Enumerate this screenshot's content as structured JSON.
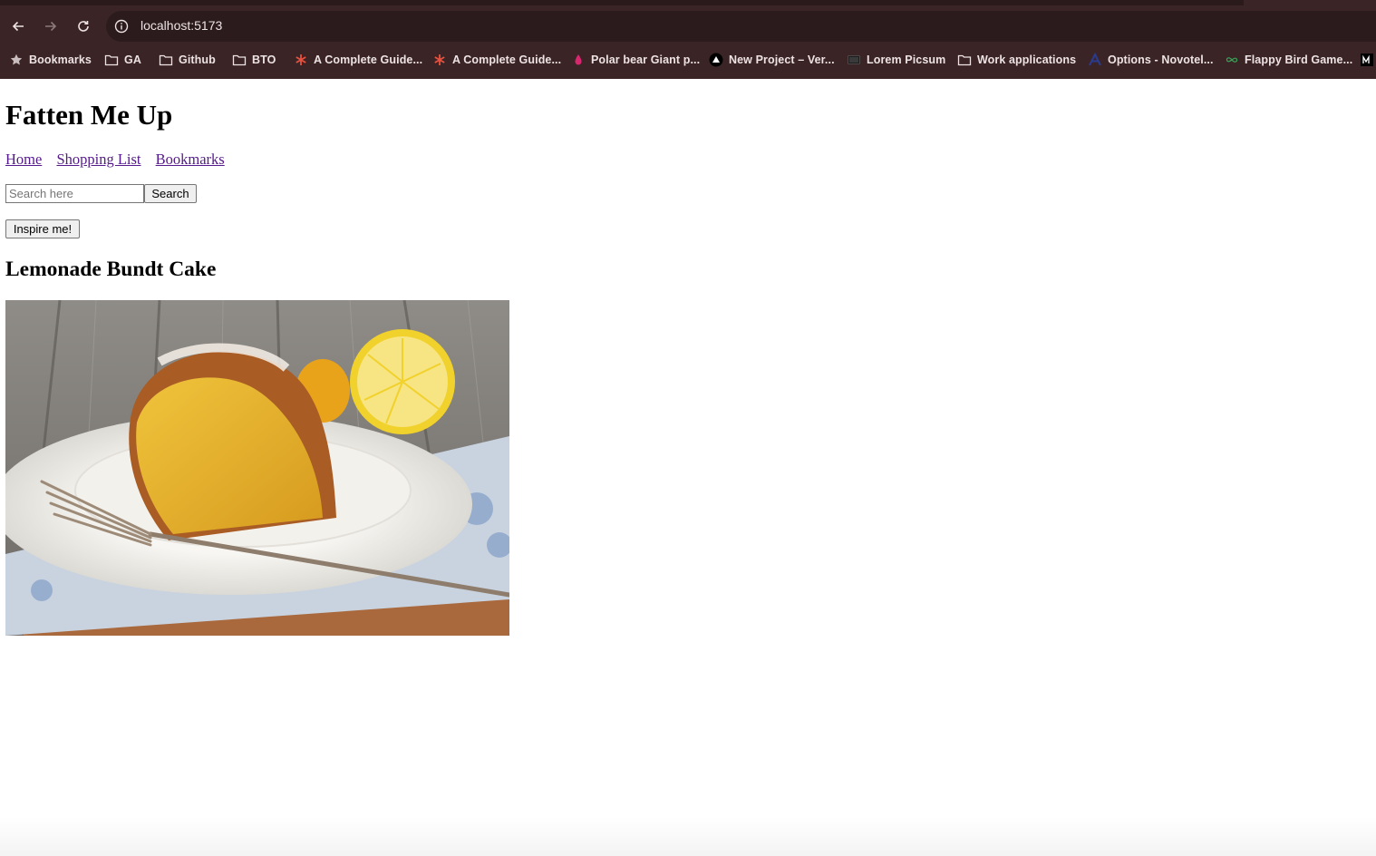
{
  "browser": {
    "url": "localhost:5173",
    "bookmarks": [
      {
        "label": "Bookmarks",
        "icon": "star-icon"
      },
      {
        "label": "GA",
        "icon": "folder-icon"
      },
      {
        "label": "Github",
        "icon": "folder-icon"
      },
      {
        "label": "BTO",
        "icon": "folder-icon"
      },
      {
        "label": "A Complete Guide...",
        "icon": "asterisk-icon"
      },
      {
        "label": "A Complete Guide...",
        "icon": "asterisk-icon"
      },
      {
        "label": "Polar bear Giant p...",
        "icon": "drop-icon"
      },
      {
        "label": "New Project – Ver...",
        "icon": "triangle-icon"
      },
      {
        "label": "Lorem Picsum",
        "icon": "image-icon"
      },
      {
        "label": "Work applications",
        "icon": "folder-icon"
      },
      {
        "label": "Options - Novotel...",
        "icon": "a-logo-icon"
      },
      {
        "label": "Flappy Bird Game...",
        "icon": "infinity-icon"
      }
    ],
    "colors": {
      "chrome": "#3b2426",
      "omnibox": "#2b1b1d",
      "text": "#ede3e4"
    }
  },
  "page": {
    "title": "Fatten Me Up",
    "nav": [
      "Home",
      "Shopping List",
      "Bookmarks"
    ],
    "search": {
      "placeholder": "Search here",
      "button": "Search"
    },
    "inspire_button": "Inspire me!",
    "recipe_title": "Lemonade Bundt Cake",
    "link_color": "#551a8b"
  }
}
